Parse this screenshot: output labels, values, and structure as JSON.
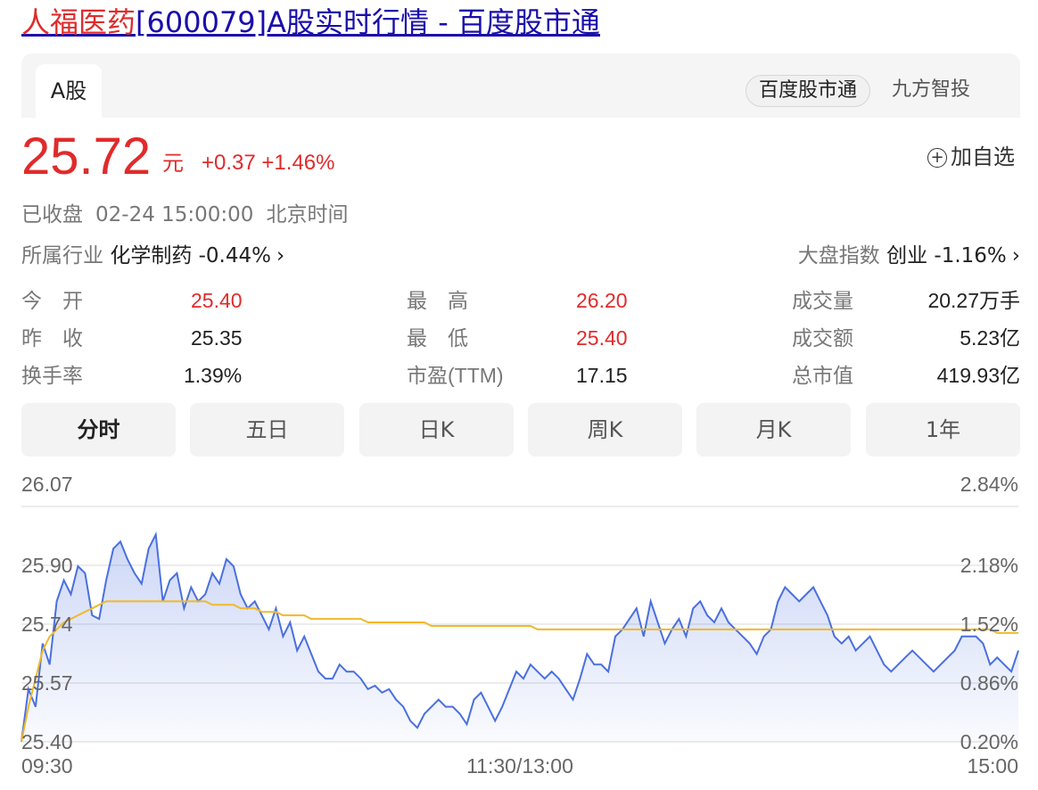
{
  "title": {
    "highlight": "人福医药",
    "rest": "[600079]A股实时行情 - 百度股市通"
  },
  "market_tab": "A股",
  "sources": [
    "百度股市通",
    "九方智投"
  ],
  "quote": {
    "price": "25.72",
    "unit": "元",
    "change": "+0.37",
    "change_pct": "+1.46%"
  },
  "watchlist_label": "加自选",
  "status": {
    "state": "已收盘",
    "datetime": "02-24 15:00:00",
    "tz": "北京时间"
  },
  "industry": {
    "label": "所属行业",
    "name": "化学制药",
    "change": "-0.44%"
  },
  "index": {
    "label": "大盘指数",
    "name": "创业",
    "change": "-1.16%"
  },
  "stats": [
    {
      "label": "今　开",
      "value": "25.40",
      "color": "#e02b2b"
    },
    {
      "label": "最　高",
      "value": "26.20",
      "color": "#e02b2b"
    },
    {
      "label": "成交量",
      "value": "20.27万手",
      "color": "#222222"
    },
    {
      "label": "昨　收",
      "value": "25.35",
      "color": "#222222"
    },
    {
      "label": "最　低",
      "value": "25.40",
      "color": "#e02b2b"
    },
    {
      "label": "成交额",
      "value": "5.23亿",
      "color": "#222222"
    },
    {
      "label": "换手率",
      "value": "1.39%",
      "color": "#222222"
    },
    {
      "label": "市盈(TTM)",
      "value": "17.15",
      "color": "#222222"
    },
    {
      "label": "总市值",
      "value": "419.93亿",
      "color": "#222222"
    }
  ],
  "tabs": [
    "分时",
    "五日",
    "日K",
    "周K",
    "月K",
    "1年"
  ],
  "active_tab": 0,
  "colors": {
    "up": "#e02b2b",
    "price_line": "#4a6fe0",
    "avg_line": "#f0b92a",
    "link": "#1a0dab"
  },
  "chart_data": {
    "type": "line",
    "ylim": [
      25.4,
      26.07
    ],
    "left_ticks": [
      "26.07",
      "25.90",
      "25.74",
      "25.57",
      "25.40"
    ],
    "right_ticks": [
      "2.84%",
      "2.18%",
      "1.52%",
      "0.86%",
      "0.20%"
    ],
    "x_ticks": [
      "09:30",
      "11:30/13:00",
      "15:00"
    ],
    "series": [
      {
        "values": [
          25.4,
          25.55,
          25.5,
          25.68,
          25.62,
          25.8,
          25.86,
          25.82,
          25.9,
          25.88,
          25.76,
          25.75,
          25.86,
          25.95,
          25.97,
          25.92,
          25.88,
          25.85,
          25.95,
          25.99,
          25.8,
          25.86,
          25.88,
          25.78,
          25.84,
          25.8,
          25.82,
          25.88,
          25.85,
          25.92,
          25.9,
          25.82,
          25.78,
          25.8,
          25.76,
          25.72,
          25.78,
          25.7,
          25.74,
          25.66,
          25.7,
          25.65,
          25.6,
          25.58,
          25.58,
          25.62,
          25.6,
          25.6,
          25.58,
          25.55,
          25.56,
          25.54,
          25.55,
          25.52,
          25.5,
          25.46,
          25.44,
          25.48,
          25.5,
          25.52,
          25.5,
          25.5,
          25.48,
          25.45,
          25.52,
          25.54,
          25.5,
          25.46,
          25.5,
          25.55,
          25.6,
          25.58,
          25.62,
          25.6,
          25.58,
          25.6,
          25.58,
          25.55,
          25.52,
          25.58,
          25.65,
          25.62,
          25.62,
          25.6,
          25.7,
          25.72,
          25.75,
          25.78,
          25.7,
          25.8,
          25.74,
          25.68,
          25.72,
          25.75,
          25.7,
          25.78,
          25.8,
          25.76,
          25.74,
          25.78,
          25.74,
          25.72,
          25.7,
          25.68,
          25.65,
          25.7,
          25.72,
          25.8,
          25.84,
          25.82,
          25.8,
          25.82,
          25.84,
          25.8,
          25.76,
          25.7,
          25.68,
          25.7,
          25.66,
          25.68,
          25.7,
          25.66,
          25.62,
          25.6,
          25.62,
          25.64,
          25.66,
          25.64,
          25.62,
          25.6,
          25.62,
          25.64,
          25.66,
          25.7,
          25.7,
          25.7,
          25.68,
          25.62,
          25.64,
          25.62,
          25.6,
          25.66
        ]
      },
      {
        "values": [
          25.4,
          25.5,
          25.58,
          25.66,
          25.7,
          25.72,
          25.74,
          25.75,
          25.76,
          25.77,
          25.78,
          25.79,
          25.8,
          25.8,
          25.8,
          25.8,
          25.8,
          25.8,
          25.8,
          25.8,
          25.8,
          25.8,
          25.8,
          25.8,
          25.8,
          25.8,
          25.8,
          25.79,
          25.79,
          25.79,
          25.79,
          25.78,
          25.78,
          25.78,
          25.77,
          25.77,
          25.77,
          25.76,
          25.76,
          25.76,
          25.76,
          25.75,
          25.75,
          25.75,
          25.75,
          25.75,
          25.75,
          25.75,
          25.75,
          25.74,
          25.74,
          25.74,
          25.74,
          25.74,
          25.74,
          25.74,
          25.74,
          25.74,
          25.73,
          25.73,
          25.73,
          25.73,
          25.73,
          25.73,
          25.73,
          25.73,
          25.73,
          25.73,
          25.73,
          25.73,
          25.73,
          25.73,
          25.73,
          25.72,
          25.72,
          25.72,
          25.72,
          25.72,
          25.72,
          25.72,
          25.72,
          25.72,
          25.72,
          25.72,
          25.72,
          25.72,
          25.72,
          25.72,
          25.72,
          25.72,
          25.72,
          25.72,
          25.72,
          25.72,
          25.72,
          25.72,
          25.72,
          25.72,
          25.72,
          25.72,
          25.72,
          25.72,
          25.72,
          25.72,
          25.72,
          25.72,
          25.72,
          25.72,
          25.72,
          25.72,
          25.72,
          25.72,
          25.72,
          25.72,
          25.72,
          25.72,
          25.72,
          25.72,
          25.72,
          25.72,
          25.72,
          25.72,
          25.72,
          25.72,
          25.72,
          25.72,
          25.72,
          25.72,
          25.72,
          25.72,
          25.72,
          25.72,
          25.72,
          25.72,
          25.72,
          25.72,
          25.72,
          25.72,
          25.71,
          25.71,
          25.71,
          25.71
        ]
      }
    ]
  }
}
